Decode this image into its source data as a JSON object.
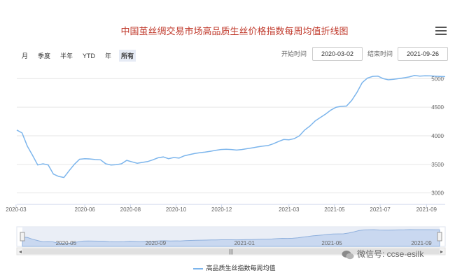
{
  "title": "中国茧丝绸交易市场高品质生丝价格指数每周均值折线图",
  "range_buttons": [
    "月",
    "季度",
    "半年",
    "YTD",
    "年",
    "所有"
  ],
  "active_range": "所有",
  "start_label": "开始时间",
  "start_value": "2020-03-02",
  "end_label": "结束时间",
  "end_value": "2021-09-26",
  "legend": "高品质生丝指数每周均值",
  "watermark": "微信号: ccse-esilk",
  "icons": {
    "menu": "hamburger-menu-icon",
    "watermark": "wechat-icon"
  },
  "colors": {
    "title": "#c0392b",
    "series": "#7cb5ec",
    "navigator_fill": "#e6ebf5"
  },
  "chart_data": {
    "type": "line",
    "title": "中国茧丝绸交易市场高品质生丝价格指数每周均值折线图",
    "xlabel": "",
    "ylabel": "",
    "ylim": [
      2800,
      5200
    ],
    "yticks": [
      3000,
      3500,
      4000,
      4500,
      5000
    ],
    "xticks": [
      "2020-03",
      "2020-06",
      "2020-08",
      "2020-10",
      "2020-12",
      "2021-03",
      "2021-05",
      "2021-07",
      "2021-09"
    ],
    "grid": true,
    "legend_position": "bottom",
    "series": [
      {
        "name": "高品质生丝指数每周均值",
        "x": [
          "2020-03-02",
          "2020-03-09",
          "2020-03-16",
          "2020-03-23",
          "2020-03-30",
          "2020-04-06",
          "2020-04-13",
          "2020-04-20",
          "2020-04-27",
          "2020-05-04",
          "2020-05-11",
          "2020-05-18",
          "2020-05-25",
          "2020-06-01",
          "2020-06-08",
          "2020-06-15",
          "2020-06-22",
          "2020-06-29",
          "2020-07-06",
          "2020-07-13",
          "2020-07-20",
          "2020-07-27",
          "2020-08-03",
          "2020-08-10",
          "2020-08-17",
          "2020-08-24",
          "2020-08-31",
          "2020-09-07",
          "2020-09-14",
          "2020-09-21",
          "2020-09-28",
          "2020-10-05",
          "2020-10-12",
          "2020-10-19",
          "2020-10-26",
          "2020-11-02",
          "2020-11-09",
          "2020-11-16",
          "2020-11-23",
          "2020-11-30",
          "2020-12-07",
          "2020-12-14",
          "2020-12-21",
          "2020-12-28",
          "2021-01-04",
          "2021-01-11",
          "2021-01-18",
          "2021-01-25",
          "2021-02-01",
          "2021-02-08",
          "2021-02-15",
          "2021-02-22",
          "2021-03-01",
          "2021-03-08",
          "2021-03-15",
          "2021-03-22",
          "2021-03-29",
          "2021-04-05",
          "2021-04-12",
          "2021-04-19",
          "2021-04-26",
          "2021-05-03",
          "2021-05-10",
          "2021-05-17",
          "2021-05-24",
          "2021-05-31",
          "2021-06-07",
          "2021-06-14",
          "2021-06-21",
          "2021-06-28",
          "2021-07-05",
          "2021-07-12",
          "2021-07-19",
          "2021-07-26",
          "2021-08-02",
          "2021-08-09",
          "2021-08-16",
          "2021-08-23",
          "2021-08-30",
          "2021-09-06",
          "2021-09-13",
          "2021-09-20",
          "2021-09-26"
        ],
        "values": [
          4100,
          4050,
          3820,
          3660,
          3490,
          3510,
          3490,
          3330,
          3290,
          3270,
          3390,
          3500,
          3590,
          3600,
          3595,
          3585,
          3580,
          3510,
          3490,
          3495,
          3510,
          3570,
          3545,
          3520,
          3535,
          3550,
          3580,
          3615,
          3630,
          3600,
          3620,
          3610,
          3650,
          3670,
          3690,
          3705,
          3715,
          3730,
          3745,
          3760,
          3765,
          3760,
          3750,
          3760,
          3775,
          3790,
          3805,
          3820,
          3830,
          3860,
          3900,
          3935,
          3930,
          3950,
          4000,
          4100,
          4170,
          4260,
          4320,
          4380,
          4450,
          4500,
          4515,
          4520,
          4620,
          4760,
          4930,
          5010,
          5040,
          5045,
          5000,
          4980,
          4990,
          5000,
          5015,
          5030,
          5055,
          5045,
          5050,
          5048,
          5042,
          5038,
          5035
        ]
      }
    ]
  }
}
